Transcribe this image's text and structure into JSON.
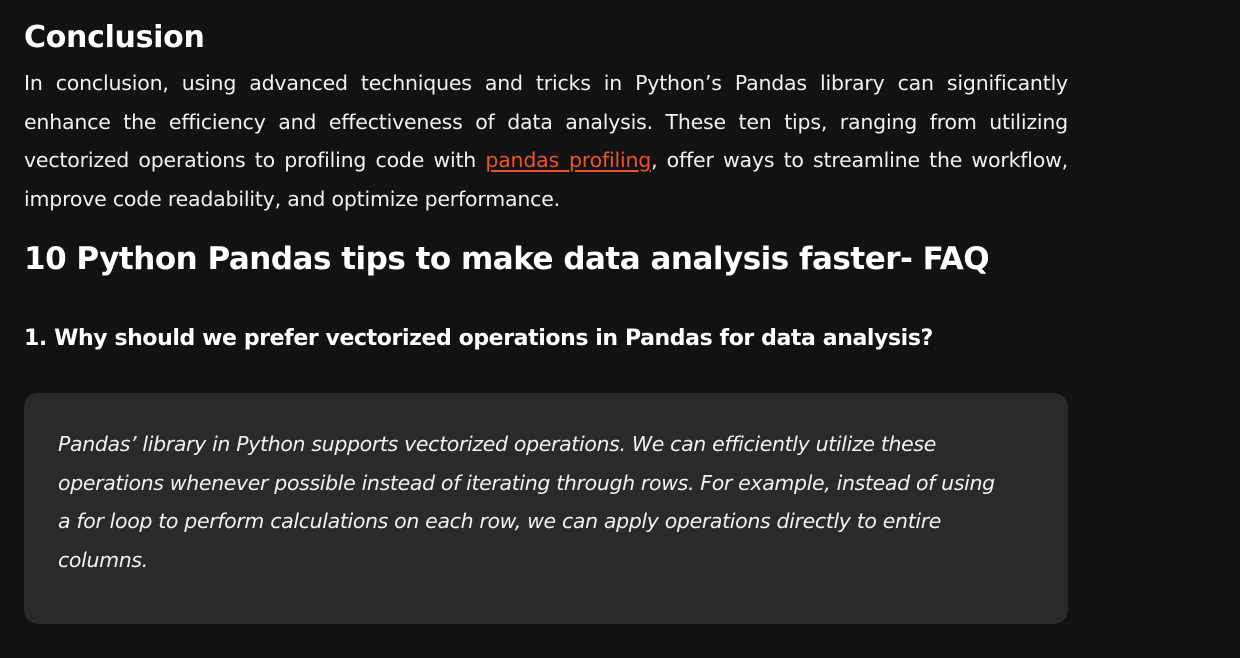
{
  "conclusion": {
    "heading": "Conclusion",
    "text_before_link": "In conclusion, using advanced techniques and tricks in Python’s Pandas library can significantly enhance the efficiency and effectiveness of data analysis. These ten tips, ranging from utilizing vectorized operations to profiling code with ",
    "link_text": "pandas_profiling",
    "text_after_link": ", offer ways to streamline the workflow, improve code readability, and optimize performance."
  },
  "faq": {
    "heading": "10 Python Pandas tips to make data analysis faster- FAQ",
    "questions": [
      {
        "question": "1. Why should we prefer vectorized operations in Pandas for data analysis?",
        "answer": "Pandas’ library in Python supports vectorized operations. We can efficiently utilize these operations whenever possible instead of iterating through rows. For example, instead of using a for loop to perform calculations on each row, we can apply operations directly to entire columns."
      }
    ]
  },
  "colors": {
    "background": "#121215",
    "card_background": "#2a2a2c",
    "link": "#e8552f",
    "text": "#ffffff"
  }
}
